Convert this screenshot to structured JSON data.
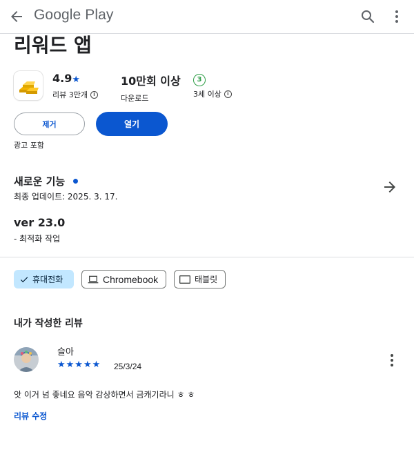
{
  "header": {
    "title": "Google Play",
    "back_icon": "arrow-back-icon",
    "search_icon": "search-icon",
    "more_icon": "more-vert-icon"
  },
  "app": {
    "title": "리워드 앱",
    "icon": "gold-bars-icon",
    "rating": "4.9",
    "rating_star": "★",
    "reviews": "리뷰 3만개",
    "downloads": "10만회 이상",
    "downloads_label": "다운로드",
    "age_rating": "3",
    "age_label": "3세 이상"
  },
  "actions": {
    "remove_label": "제거",
    "open_label": "열기",
    "ads_label": "광고 포함"
  },
  "whats_new": {
    "title": "새로운 기능",
    "updated": "최종 업데이트: 2025. 3. 17.",
    "version": "ver 23.0",
    "note": "- 최적화 작업"
  },
  "devices": [
    {
      "label": "휴대전화",
      "icon": "check-icon",
      "selected": true
    },
    {
      "label": "Chromebook",
      "icon": "laptop-icon",
      "selected": false
    },
    {
      "label": "태블릿",
      "icon": "tablet-icon",
      "selected": false
    }
  ],
  "my_review": {
    "heading": "내가 작성한 리뷰",
    "reviewer": "슬아",
    "stars": "★★★★★",
    "rating": 5,
    "date": "25/3/24",
    "text": "앗 이거 넘 좋네요 음악 감상하면서 금캐기라니 ㅎ ㅎ",
    "edit_label": "리뷰 수정"
  },
  "colors": {
    "accent": "#0b57d0",
    "chip_selected": "#c2e7ff",
    "age_badge": "#2e9e47",
    "divider": "#dadce0"
  }
}
